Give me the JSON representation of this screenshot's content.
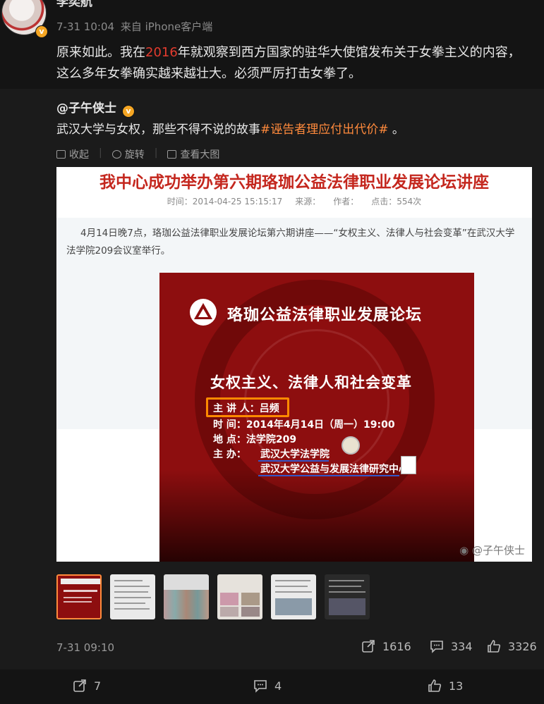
{
  "post": {
    "author": "李奕航",
    "time": "7-31 10:04",
    "source": "来自 iPhone客户端",
    "text_before": "原来如此。我在",
    "text_highlight": "2016",
    "text_after": "年就观察到西方国家的驻华大使馆发布关于女拳主义的内容，这么多年女拳确实越来越壮大。必须严厉打击女拳了。"
  },
  "repost": {
    "author": "@子午侠士",
    "text_before": "武汉大学与女权，那些不得不说的故事",
    "hashtag": "#诬告者理应付出代价#",
    "text_after": " 。",
    "tools": {
      "collect": "收起",
      "rotate": "旋转",
      "view_large": "查看大图"
    },
    "time": "7-31 09:10",
    "stats": {
      "reposts": "1616",
      "comments": "334",
      "likes": "3326"
    }
  },
  "article": {
    "title": "我中心成功举办第六期珞珈公益法律职业发展论坛讲座",
    "meta_time": "时间：2014-04-25 15:15:17",
    "meta_source": "来源：",
    "meta_author": "作者：",
    "meta_clicks": "点击：554次",
    "body_line1": "4月14日晚7点，珞珈公益法律职业发展论坛第六期讲座——“女权主义、法律人与社会变革”在武汉大学",
    "body_line2": "法学院209会议室举行。"
  },
  "poster": {
    "forum": "珞珈公益法律职业发展论坛",
    "topic": "女权主义、法律人和社会变革",
    "speaker": "主  讲 人：吕频",
    "time": "时    间：2014年4月14日（周一）19:00",
    "place": "地    点：法学院209",
    "host_label": "主    办：",
    "host1": "武汉大学法学院",
    "host2": "武汉大学公益与发展法律研究中心"
  },
  "watermark": "@子午侠士",
  "actions": {
    "share": "7",
    "comment": "4",
    "like": "13"
  },
  "colors": {
    "highlight_red": "#e33b2e",
    "hashtag_orange": "#ff8a3c",
    "verified": "#f5a623",
    "poster_red": "#8d0e0f"
  },
  "icons": [
    "verified-badge-icon",
    "collect-icon",
    "rotate-icon",
    "view-large-icon",
    "repost-icon",
    "comment-icon",
    "like-icon",
    "weibo-logo-icon"
  ]
}
